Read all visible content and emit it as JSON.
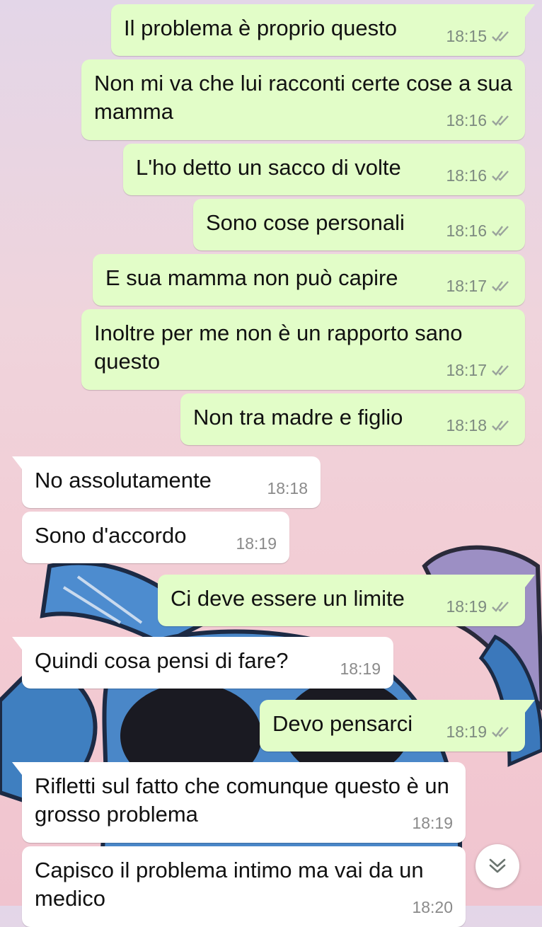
{
  "colors": {
    "outgoing_bubble": "#e2fdc8",
    "incoming_bubble": "#ffffff",
    "timestamp": "#7d8a80",
    "read_ticks": "#9aa39c"
  },
  "messages": [
    {
      "direction": "out",
      "text": "Il problema è proprio questo",
      "time": "18:15",
      "status_icon": "double-check-icon"
    },
    {
      "direction": "out",
      "text": "Non mi va che lui racconti certe cose a sua mamma",
      "time": "18:16",
      "status_icon": "double-check-icon"
    },
    {
      "direction": "out",
      "text": "L'ho detto un sacco di volte",
      "time": "18:16",
      "status_icon": "double-check-icon"
    },
    {
      "direction": "out",
      "text": "Sono cose personali",
      "time": "18:16",
      "status_icon": "double-check-icon"
    },
    {
      "direction": "out",
      "text": "E sua mamma non può capire",
      "time": "18:17",
      "status_icon": "double-check-icon"
    },
    {
      "direction": "out",
      "text": "Inoltre per me non è un rapporto sano questo",
      "time": "18:17",
      "status_icon": "double-check-icon"
    },
    {
      "direction": "out",
      "text": "Non tra madre e figlio",
      "time": "18:18",
      "status_icon": "double-check-icon"
    },
    {
      "direction": "in",
      "text": "No assolutamente",
      "time": "18:18"
    },
    {
      "direction": "in",
      "text": "Sono d'accordo",
      "time": "18:19"
    },
    {
      "direction": "out",
      "text": "Ci deve essere un limite",
      "time": "18:19",
      "status_icon": "double-check-icon"
    },
    {
      "direction": "in",
      "text": "Quindi cosa pensi di fare?",
      "time": "18:19"
    },
    {
      "direction": "out",
      "text": "Devo pensarci",
      "time": "18:19",
      "status_icon": "double-check-icon"
    },
    {
      "direction": "in",
      "text": "Rifletti sul fatto che comunque questo è un grosso problema",
      "time": "18:19"
    },
    {
      "direction": "in",
      "text": "Capisco il problema intimo ma vai da un medico",
      "time": "18:20"
    }
  ],
  "scroll_button_icon": "double-chevron-down-icon"
}
